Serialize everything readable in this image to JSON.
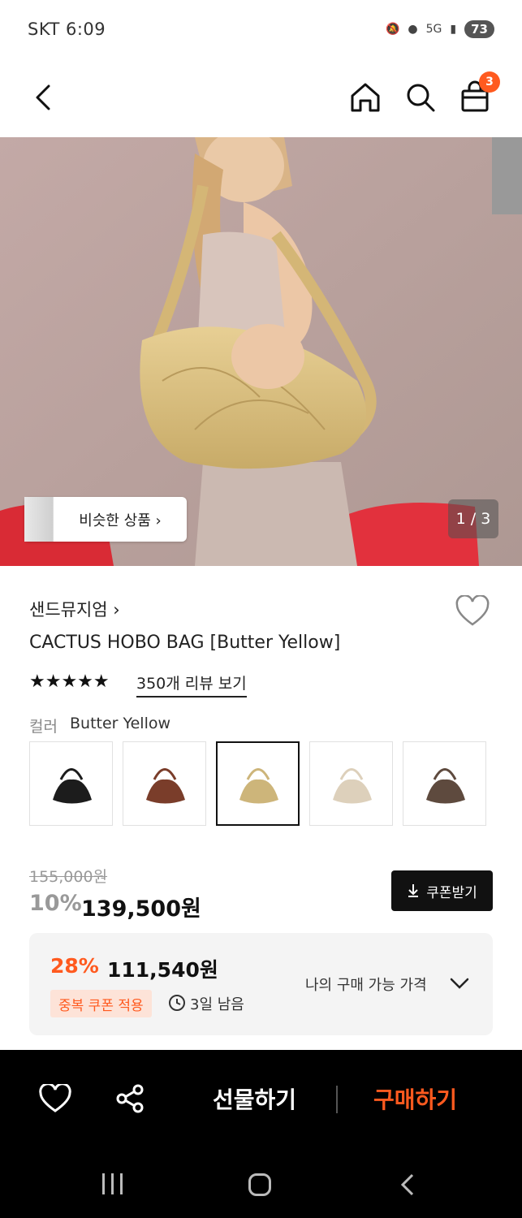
{
  "status": {
    "carrier_time": "SKT 6:09",
    "network": "5G",
    "battery": "73"
  },
  "header": {
    "cart_count": "3",
    "icons": [
      "back-icon",
      "home-icon",
      "search-icon",
      "shopping-bag-icon"
    ]
  },
  "hero": {
    "similar_label": "비슷한 상품 ›",
    "pager": "1 / 3"
  },
  "product": {
    "brand": "샌드뮤지엄 ›",
    "title": "CACTUS HOBO BAG [Butter Yellow]",
    "stars": "★★★★★",
    "review_link": "350개 리뷰 보기",
    "color_label": "컬러",
    "color_value": "Butter Yellow",
    "swatches": [
      "#1c1c1c",
      "#7a3d2a",
      "#cdb57a",
      "#ddd0bb",
      "#5e4a3e"
    ],
    "original_price": "155,000원",
    "discount": "10%",
    "price": "139,500원",
    "coupon_button": "쿠폰받기"
  },
  "my_price": {
    "discount": "28%",
    "amount": "111,540원",
    "coupon_tag": "중복 쿠폰 적용",
    "days_left": "3일 남음",
    "toggle_label": "나의 구매 가능 가격"
  },
  "actions": {
    "gift": "선물하기",
    "buy": "구매하기"
  },
  "colors": {
    "accent": "#ff5a1f",
    "bar": "#000000"
  }
}
